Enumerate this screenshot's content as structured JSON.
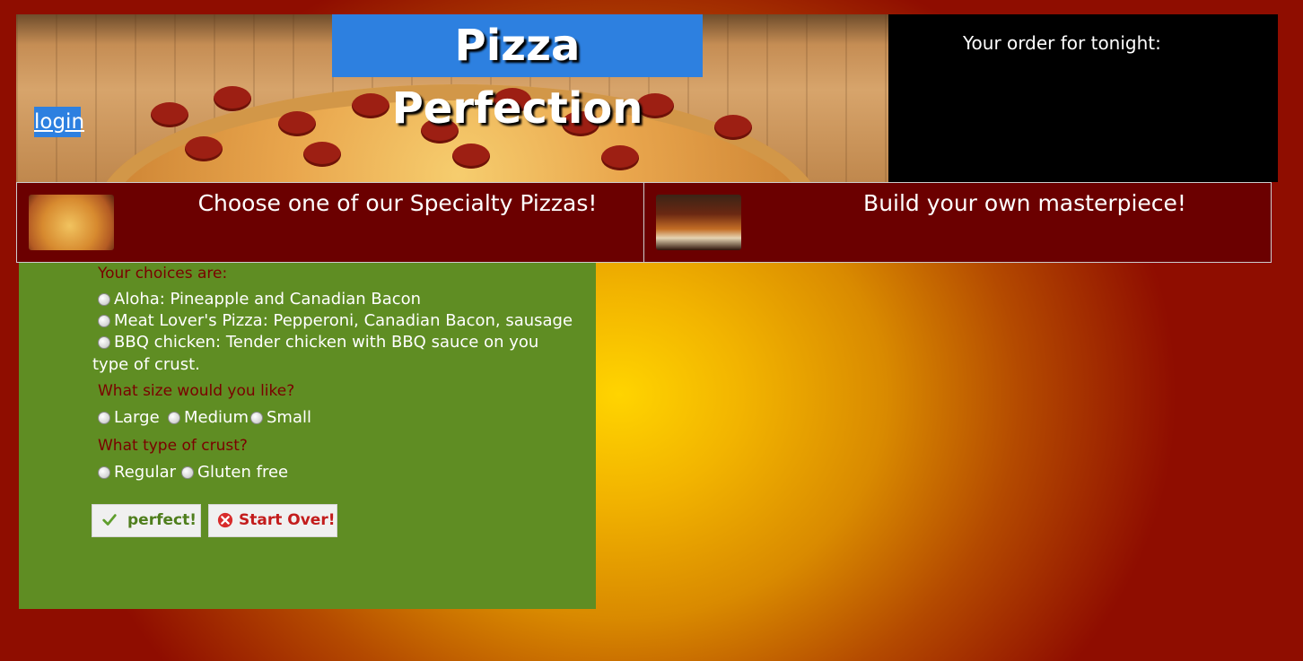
{
  "header": {
    "title": "Pizza Perfection",
    "login_label": "login"
  },
  "order": {
    "label": "Your order for tonight:"
  },
  "menu": {
    "specialty_label": "Choose one of our Specialty Pizzas!",
    "build_label": "Build your own masterpiece!"
  },
  "form": {
    "choices_heading": "Your choices are:",
    "choices": [
      "Aloha: Pineapple and Canadian Bacon",
      "Meat Lover's Pizza: Pepperoni, Canadian Bacon, sausage",
      "BBQ chicken: Tender chicken with BBQ sauce on you",
      "type of crust."
    ],
    "size_heading": "What size would you like?",
    "sizes": [
      "Large",
      "Medium",
      "Small"
    ],
    "crust_heading": "What type of crust?",
    "crusts": [
      "Regular",
      "Gluten free"
    ],
    "buttons": {
      "perfect": "perfect!",
      "start_over": "Start Over!"
    }
  }
}
